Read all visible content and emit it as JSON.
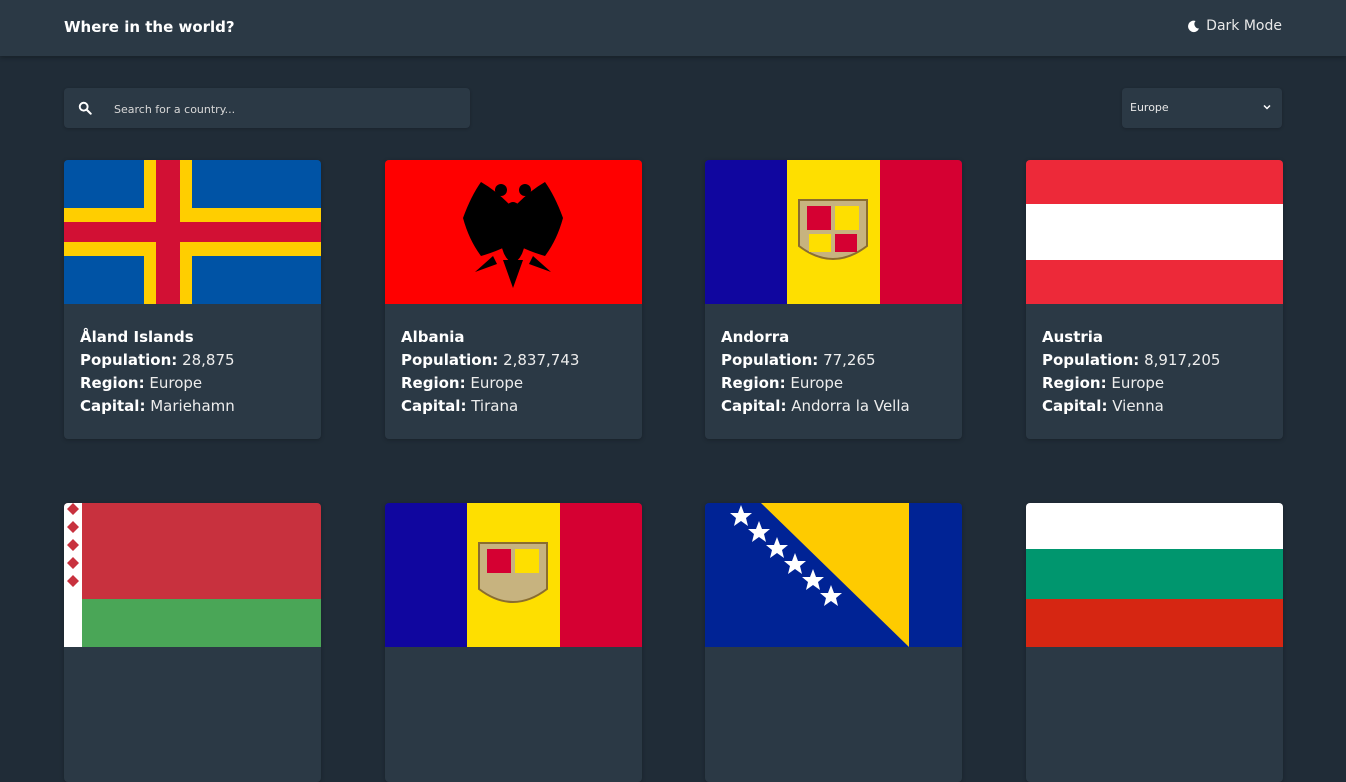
{
  "header": {
    "title": "Where in the world?",
    "theme_toggle_label": "Dark Mode",
    "theme_icon": "moon-icon"
  },
  "search": {
    "placeholder": "Search for a country...",
    "value": "",
    "icon": "search-icon"
  },
  "filter": {
    "selected": "Europe",
    "icon": "chevron-down-icon"
  },
  "labels": {
    "population": "Population:",
    "region": "Region:",
    "capital": "Capital:"
  },
  "countries": [
    {
      "name": "Åland Islands",
      "population": "28,875",
      "region": "Europe",
      "capital": "Mariehamn",
      "flag": "aland-islands-flag"
    },
    {
      "name": "Albania",
      "population": "2,837,743",
      "region": "Europe",
      "capital": "Tirana",
      "flag": "albania-flag"
    },
    {
      "name": "Andorra",
      "population": "77,265",
      "region": "Europe",
      "capital": "Andorra la Vella",
      "flag": "andorra-flag"
    },
    {
      "name": "Austria",
      "population": "8,917,205",
      "region": "Europe",
      "capital": "Vienna",
      "flag": "austria-flag"
    },
    {
      "flag": "belarus-flag"
    },
    {
      "flag": "andorra-flag"
    },
    {
      "flag": "bosnia-and-herzegovina-flag"
    },
    {
      "flag": "bulgaria-flag"
    }
  ],
  "colors": {
    "background": "#202c37",
    "elements": "#2b3945",
    "text": "#ffffff"
  }
}
